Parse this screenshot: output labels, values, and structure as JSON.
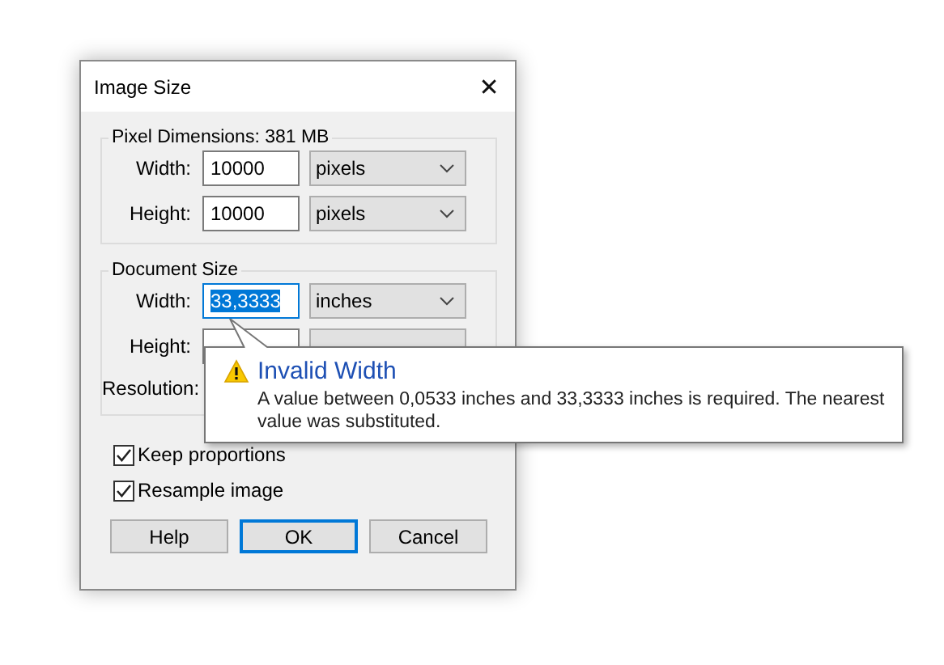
{
  "window": {
    "title": "Image Size",
    "close": "✕"
  },
  "pixel_dimensions": {
    "legend": "Pixel Dimensions: 381 MB",
    "rows": [
      {
        "label": "Width:",
        "value": "10000",
        "unit": "pixels"
      },
      {
        "label": "Height:",
        "value": "10000",
        "unit": "pixels"
      }
    ]
  },
  "document_size": {
    "legend": "Document Size",
    "rows": [
      {
        "label": "Width:",
        "value": "33,3333",
        "unit": "inches",
        "focused": true
      },
      {
        "label": "Height:",
        "focused": false
      }
    ],
    "resolution_label": "Resolution:"
  },
  "options": [
    {
      "label": "Keep proportions",
      "checked": true
    },
    {
      "label": "Resample image",
      "checked": true
    }
  ],
  "buttons": [
    {
      "label": "Help",
      "selected": false
    },
    {
      "label": "OK",
      "selected": true
    },
    {
      "label": "Cancel",
      "selected": false
    }
  ],
  "tooltip": {
    "title": "Invalid Width",
    "message": "A value between 0,0533 inches and 33,3333 inches is required. The nearest value was substituted."
  }
}
